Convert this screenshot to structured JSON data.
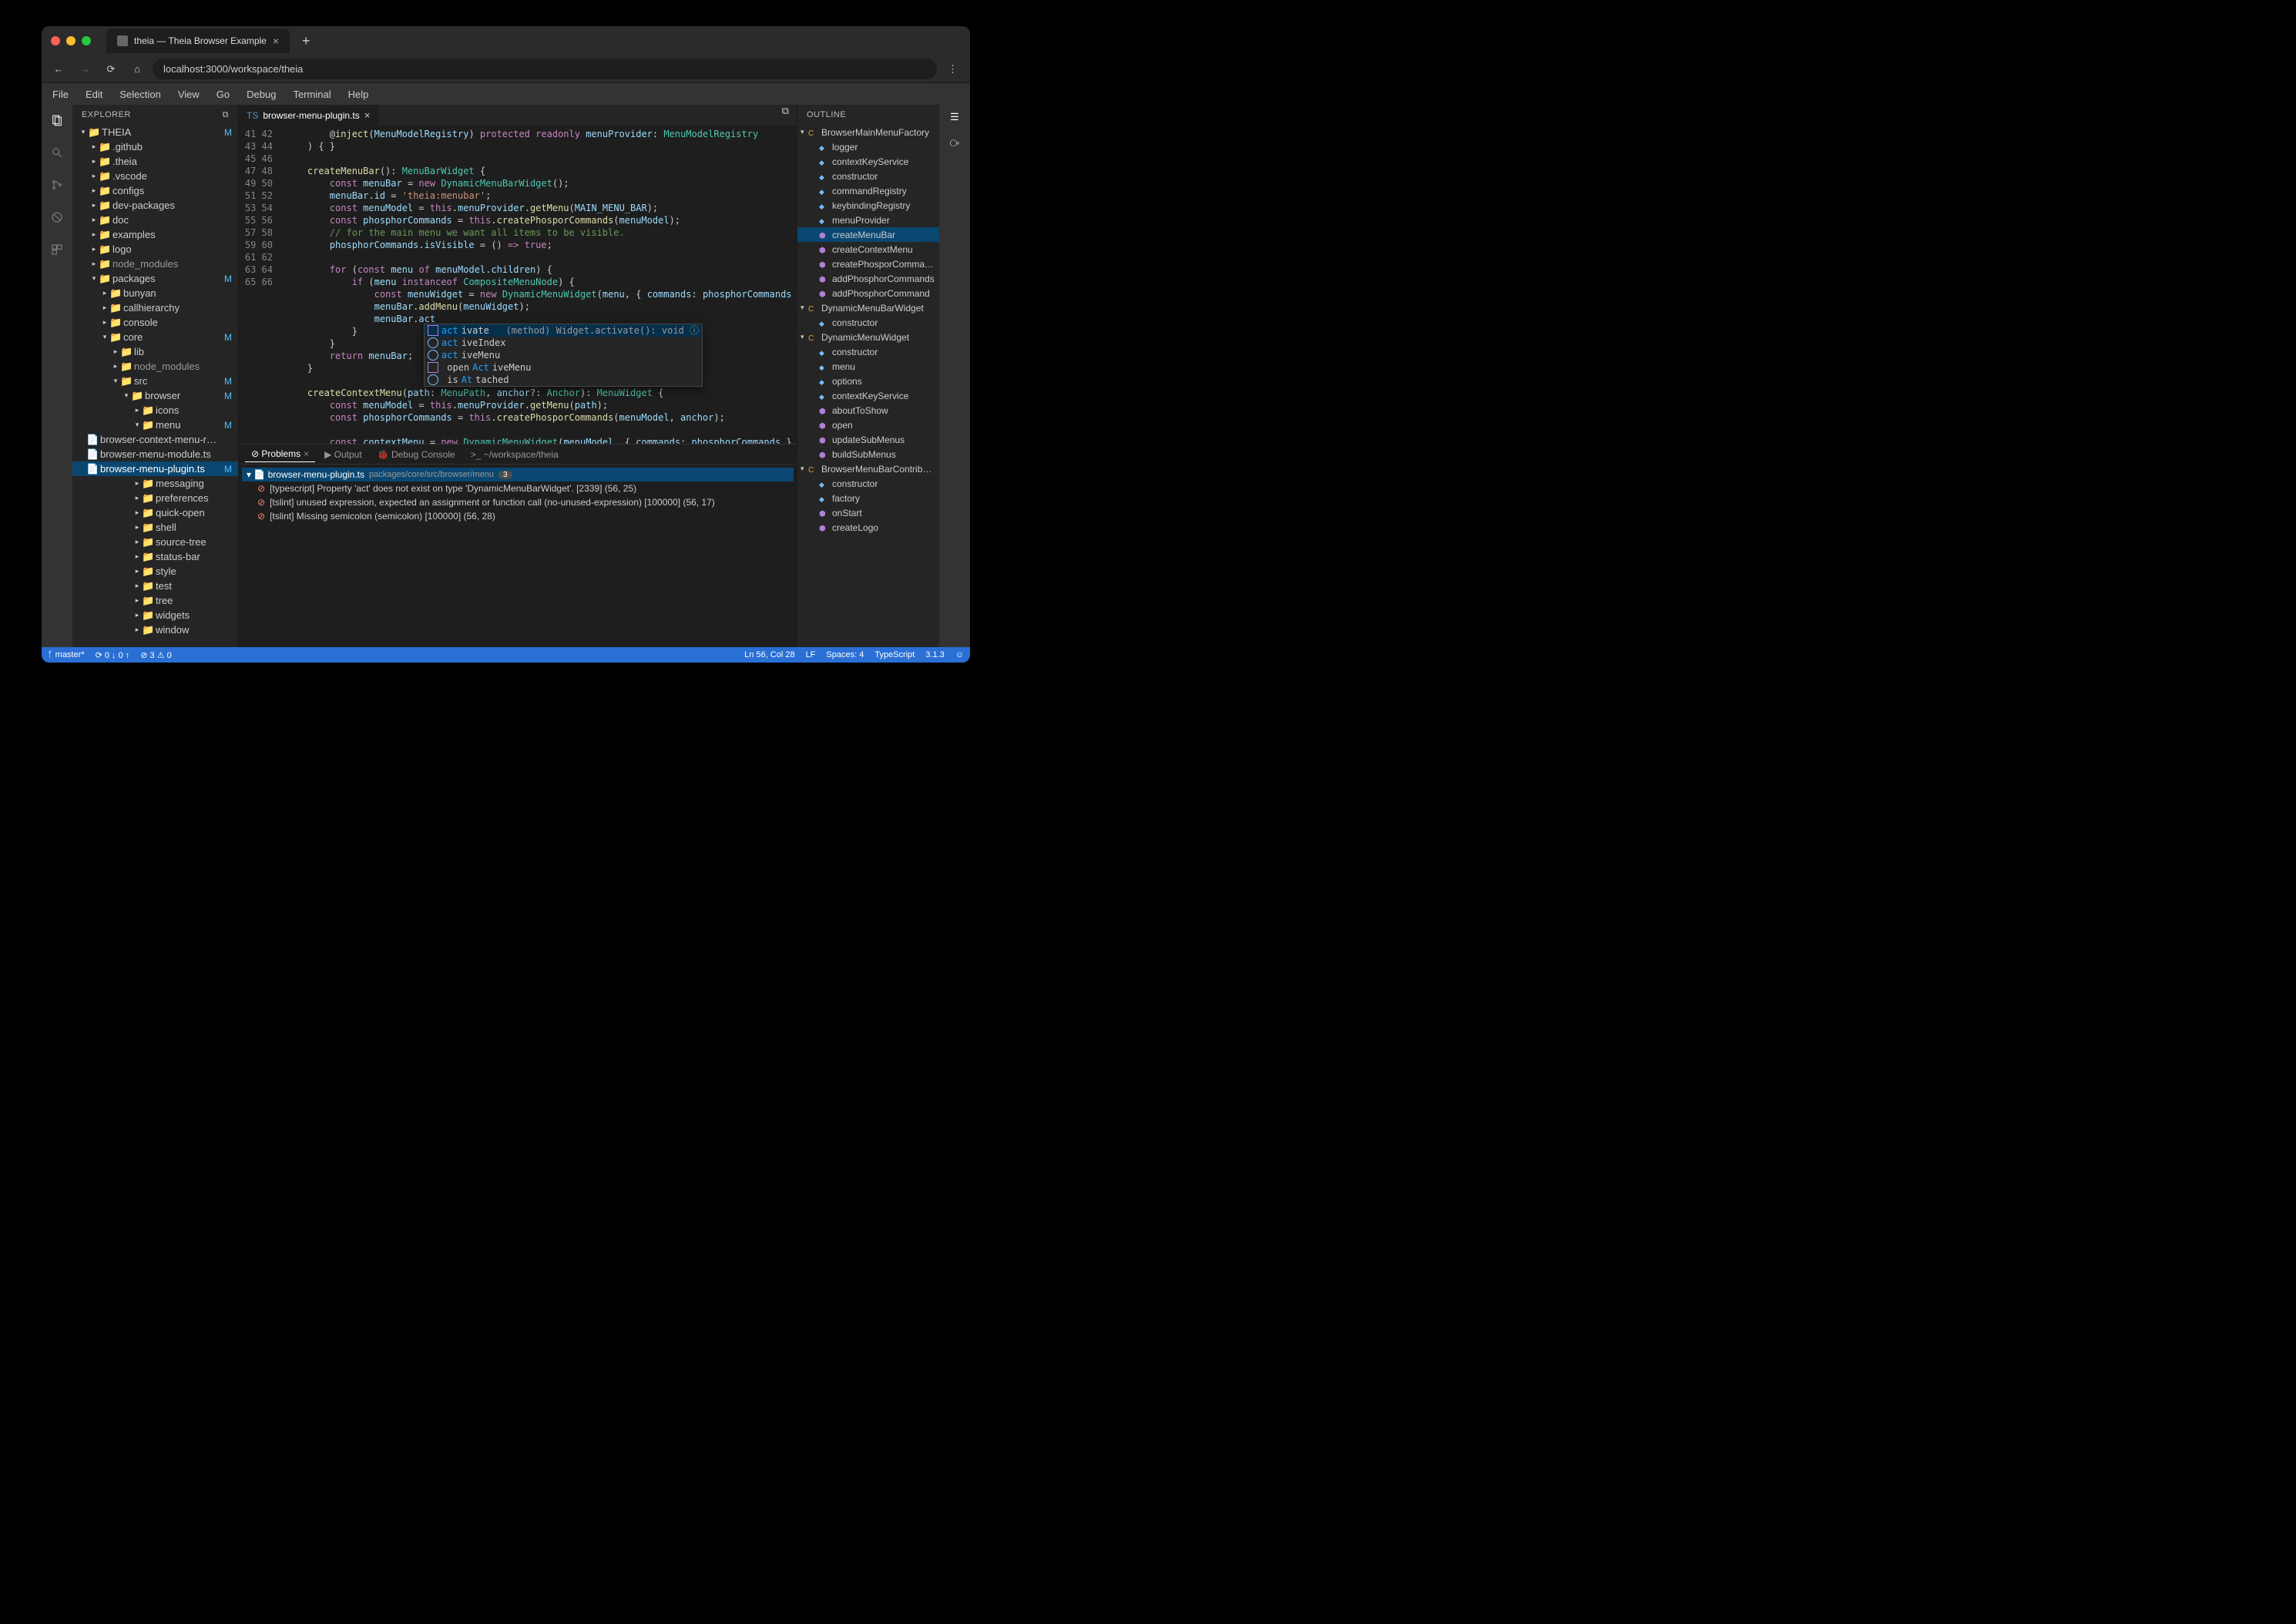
{
  "browser": {
    "tab_title": "theia — Theia Browser Example",
    "url": "localhost:3000/workspace/theia"
  },
  "menubar": [
    "File",
    "Edit",
    "Selection",
    "View",
    "Go",
    "Debug",
    "Terminal",
    "Help"
  ],
  "explorer": {
    "title": "EXPLORER",
    "root": "THEIA",
    "root_badge": "M",
    "items": [
      {
        "d": 1,
        "t": "folder",
        "n": ".github",
        "exp": false
      },
      {
        "d": 1,
        "t": "folder",
        "n": ".theia",
        "exp": false
      },
      {
        "d": 1,
        "t": "folder",
        "n": ".vscode",
        "exp": false
      },
      {
        "d": 1,
        "t": "folder",
        "n": "configs",
        "exp": false
      },
      {
        "d": 1,
        "t": "folder",
        "n": "dev-packages",
        "exp": false
      },
      {
        "d": 1,
        "t": "folder",
        "n": "doc",
        "exp": false
      },
      {
        "d": 1,
        "t": "folder",
        "n": "examples",
        "exp": false
      },
      {
        "d": 1,
        "t": "folder",
        "n": "logo",
        "exp": false
      },
      {
        "d": 1,
        "t": "folder",
        "n": "node_modules",
        "exp": false,
        "dim": true
      },
      {
        "d": 1,
        "t": "folder",
        "n": "packages",
        "exp": true,
        "badge": "M"
      },
      {
        "d": 2,
        "t": "folder",
        "n": "bunyan",
        "exp": false
      },
      {
        "d": 2,
        "t": "folder",
        "n": "callhierarchy",
        "exp": false
      },
      {
        "d": 2,
        "t": "folder",
        "n": "console",
        "exp": false
      },
      {
        "d": 2,
        "t": "folder",
        "n": "core",
        "exp": true,
        "badge": "M"
      },
      {
        "d": 3,
        "t": "folder",
        "n": "lib",
        "exp": false
      },
      {
        "d": 3,
        "t": "folder",
        "n": "node_modules",
        "exp": false,
        "dim": true
      },
      {
        "d": 3,
        "t": "folder",
        "n": "src",
        "exp": true,
        "badge": "M"
      },
      {
        "d": 4,
        "t": "folder",
        "n": "browser",
        "exp": true,
        "badge": "M"
      },
      {
        "d": 5,
        "t": "folder",
        "n": "icons",
        "exp": false
      },
      {
        "d": 5,
        "t": "folder",
        "n": "menu",
        "exp": true,
        "badge": "M"
      },
      {
        "d": 6,
        "t": "file",
        "n": "browser-context-menu-r…"
      },
      {
        "d": 6,
        "t": "file",
        "n": "browser-menu-module.ts"
      },
      {
        "d": 6,
        "t": "file",
        "n": "browser-menu-plugin.ts",
        "sel": true,
        "badge": "M"
      },
      {
        "d": 5,
        "t": "folder",
        "n": "messaging",
        "exp": false
      },
      {
        "d": 5,
        "t": "folder",
        "n": "preferences",
        "exp": false
      },
      {
        "d": 5,
        "t": "folder",
        "n": "quick-open",
        "exp": false
      },
      {
        "d": 5,
        "t": "folder",
        "n": "shell",
        "exp": false
      },
      {
        "d": 5,
        "t": "folder",
        "n": "source-tree",
        "exp": false
      },
      {
        "d": 5,
        "t": "folder",
        "n": "status-bar",
        "exp": false
      },
      {
        "d": 5,
        "t": "folder",
        "n": "style",
        "exp": false
      },
      {
        "d": 5,
        "t": "folder",
        "n": "test",
        "exp": false
      },
      {
        "d": 5,
        "t": "folder",
        "n": "tree",
        "exp": false
      },
      {
        "d": 5,
        "t": "folder",
        "n": "widgets",
        "exp": false
      },
      {
        "d": 5,
        "t": "folder",
        "n": "window",
        "exp": false
      }
    ]
  },
  "editor": {
    "tab": "browser-menu-plugin.ts",
    "lines": [
      {
        "n": 41,
        "html": "        @<span class='fn'>inject</span>(<span class='id'>MenuModelRegistry</span>) <span class='kw'>protected</span> <span class='kw'>readonly</span> <span class='id'>menuProvider</span>: <span class='ty'>MenuModelRegistry</span>"
      },
      {
        "n": 42,
        "html": "    ) { }"
      },
      {
        "n": 43,
        "html": ""
      },
      {
        "n": 44,
        "html": "    <span class='fn'>createMenuBar</span>(): <span class='ty'>MenuBarWidget</span> {"
      },
      {
        "n": 45,
        "html": "        <span class='kw'>const</span> <span class='id'>menuBar</span> = <span class='kw'>new</span> <span class='ty'>DynamicMenuBarWidget</span>();"
      },
      {
        "n": 46,
        "html": "        <span class='id'>menuBar</span>.<span class='id'>id</span> = <span class='st'>'theia:menubar'</span>;"
      },
      {
        "n": 47,
        "html": "        <span class='kw'>const</span> <span class='id'>menuModel</span> = <span class='kw'>this</span>.<span class='id'>menuProvider</span>.<span class='fn'>getMenu</span>(<span class='id'>MAIN_MENU_BAR</span>);"
      },
      {
        "n": 48,
        "html": "        <span class='kw'>const</span> <span class='id'>phosphorCommands</span> = <span class='kw'>this</span>.<span class='fn'>createPhosporCommands</span>(<span class='id'>menuModel</span>);"
      },
      {
        "n": 49,
        "html": "        <span class='cm'>// for the main menu we want all items to be visible.</span>"
      },
      {
        "n": 50,
        "html": "        <span class='id'>phosphorCommands</span>.<span class='id'>isVisible</span> = () <span class='kw'>=&gt;</span> <span class='kw'>true</span>;"
      },
      {
        "n": 51,
        "html": ""
      },
      {
        "n": 52,
        "html": "        <span class='kw'>for</span> (<span class='kw'>const</span> <span class='id'>menu</span> <span class='kw'>of</span> <span class='id'>menuModel</span>.<span class='id'>children</span>) {"
      },
      {
        "n": 53,
        "html": "            <span class='kw'>if</span> (<span class='id'>menu</span> <span class='kw'>instanceof</span> <span class='ty'>CompositeMenuNode</span>) {"
      },
      {
        "n": 54,
        "html": "                <span class='kw'>const</span> <span class='id'>menuWidget</span> = <span class='kw'>new</span> <span class='ty'>DynamicMenuWidget</span>(<span class='id'>menu</span>, { <span class='id'>commands</span>: <span class='id'>phosphorCommands</span> }, <span class='kw'>this</span>.<span class='id'>co</span>"
      },
      {
        "n": 55,
        "html": "                <span class='id'>menuBar</span>.<span class='fn'>addMenu</span>(<span class='id'>menuWidget</span>);"
      },
      {
        "n": 56,
        "html": "                <span class='id'>menuBar</span>.<span class='id'>act</span>"
      },
      {
        "n": 57,
        "html": "            }"
      },
      {
        "n": 58,
        "html": "        }"
      },
      {
        "n": 59,
        "html": "        <span class='kw'>return</span> <span class='id'>menuBar</span>;"
      },
      {
        "n": 60,
        "html": "    }"
      },
      {
        "n": 61,
        "html": ""
      },
      {
        "n": 62,
        "html": "    <span class='fn'>createContextMenu</span>(<span class='id'>path</span>: <span class='ty'>MenuPath</span>, <span class='id'>anchor</span>?: <span class='ty'>Anchor</span>): <span class='ty'>MenuWidget</span> {"
      },
      {
        "n": 63,
        "html": "        <span class='kw'>const</span> <span class='id'>menuModel</span> = <span class='kw'>this</span>.<span class='id'>menuProvider</span>.<span class='fn'>getMenu</span>(<span class='id'>path</span>);"
      },
      {
        "n": 64,
        "html": "        <span class='kw'>const</span> <span class='id'>phosphorCommands</span> = <span class='kw'>this</span>.<span class='fn'>createPhosporCommands</span>(<span class='id'>menuModel</span>, <span class='id'>anchor</span>);"
      },
      {
        "n": 65,
        "html": ""
      },
      {
        "n": 66,
        "html": "        <span class='kw'>const</span> <span class='id'>contextMenu</span> = <span class='kw'>new</span> <span class='ty'>DynamicMenuWidget</span>(<span class='id'>menuModel</span>, { <span class='id'>commands</span>: <span class='id'>phosphorCommands</span> }, <span class='kw'>this</span>.<span class='id'>cont</span>"
      }
    ],
    "suggest": {
      "doc": "(method) Widget.activate(): void",
      "items": [
        {
          "label": "activate",
          "match": "act",
          "kind": "method",
          "sel": true
        },
        {
          "label": "activeIndex",
          "match": "act",
          "kind": "field"
        },
        {
          "label": "activeMenu",
          "match": "act",
          "kind": "field"
        },
        {
          "label": "openActiveMenu",
          "match": "Act",
          "kind": "method"
        },
        {
          "label": "isAttached",
          "match": "At",
          "kind": "field"
        }
      ]
    }
  },
  "problems": {
    "tabs": [
      "Problems",
      "Output",
      "Debug Console",
      "~/workspace/theia"
    ],
    "file": "browser-menu-plugin.ts",
    "file_path": "packages/core/src/browser/menu",
    "count": "3",
    "items": [
      {
        "src": "[typescript]",
        "msg": "Property 'act' does not exist on type 'DynamicMenuBarWidget'.",
        "code": "[2339]",
        "loc": "(56, 25)"
      },
      {
        "src": "[tslint]",
        "msg": "unused expression, expected an assignment or function call (no-unused-expression)",
        "code": "[100000]",
        "loc": "(56, 17)"
      },
      {
        "src": "[tslint]",
        "msg": "Missing semicolon (semicolon)",
        "code": "[100000]",
        "loc": "(56, 28)"
      }
    ]
  },
  "outline": {
    "title": "OUTLINE",
    "items": [
      {
        "d": 0,
        "k": "class",
        "n": "BrowserMainMenuFactory",
        "exp": true
      },
      {
        "d": 1,
        "k": "field",
        "n": "logger"
      },
      {
        "d": 1,
        "k": "field",
        "n": "contextKeyService"
      },
      {
        "d": 1,
        "k": "field",
        "n": "constructor"
      },
      {
        "d": 1,
        "k": "field",
        "n": "commandRegistry"
      },
      {
        "d": 1,
        "k": "field",
        "n": "keybindingRegistry"
      },
      {
        "d": 1,
        "k": "field",
        "n": "menuProvider"
      },
      {
        "d": 1,
        "k": "method",
        "n": "createMenuBar",
        "sel": true
      },
      {
        "d": 1,
        "k": "method",
        "n": "createContextMenu"
      },
      {
        "d": 1,
        "k": "method",
        "n": "createPhosporComma…"
      },
      {
        "d": 1,
        "k": "method",
        "n": "addPhosphorCommands"
      },
      {
        "d": 1,
        "k": "method",
        "n": "addPhosphorCommand"
      },
      {
        "d": 0,
        "k": "class",
        "n": "DynamicMenuBarWidget",
        "exp": true
      },
      {
        "d": 1,
        "k": "field",
        "n": "constructor"
      },
      {
        "d": 0,
        "k": "class",
        "n": "DynamicMenuWidget",
        "exp": true
      },
      {
        "d": 1,
        "k": "field",
        "n": "constructor"
      },
      {
        "d": 1,
        "k": "field",
        "n": "menu"
      },
      {
        "d": 1,
        "k": "field",
        "n": "options"
      },
      {
        "d": 1,
        "k": "field",
        "n": "contextKeyService"
      },
      {
        "d": 1,
        "k": "method",
        "n": "aboutToShow"
      },
      {
        "d": 1,
        "k": "method",
        "n": "open"
      },
      {
        "d": 1,
        "k": "method",
        "n": "updateSubMenus"
      },
      {
        "d": 1,
        "k": "method",
        "n": "buildSubMenus"
      },
      {
        "d": 0,
        "k": "class",
        "n": "BrowserMenuBarContrib…",
        "exp": true
      },
      {
        "d": 1,
        "k": "field",
        "n": "constructor"
      },
      {
        "d": 1,
        "k": "field",
        "n": "factory"
      },
      {
        "d": 1,
        "k": "method",
        "n": "onStart"
      },
      {
        "d": 1,
        "k": "method",
        "n": "createLogo"
      }
    ]
  },
  "statusbar": {
    "branch": "master*",
    "sync": "⟳ 0 ↓ 0 ↑",
    "errors": "⊘ 3 ⚠ 0",
    "right": {
      "pos": "Ln 56, Col 28",
      "eol": "LF",
      "indent": "Spaces: 4",
      "lang": "TypeScript",
      "ver": "3.1.3"
    }
  }
}
